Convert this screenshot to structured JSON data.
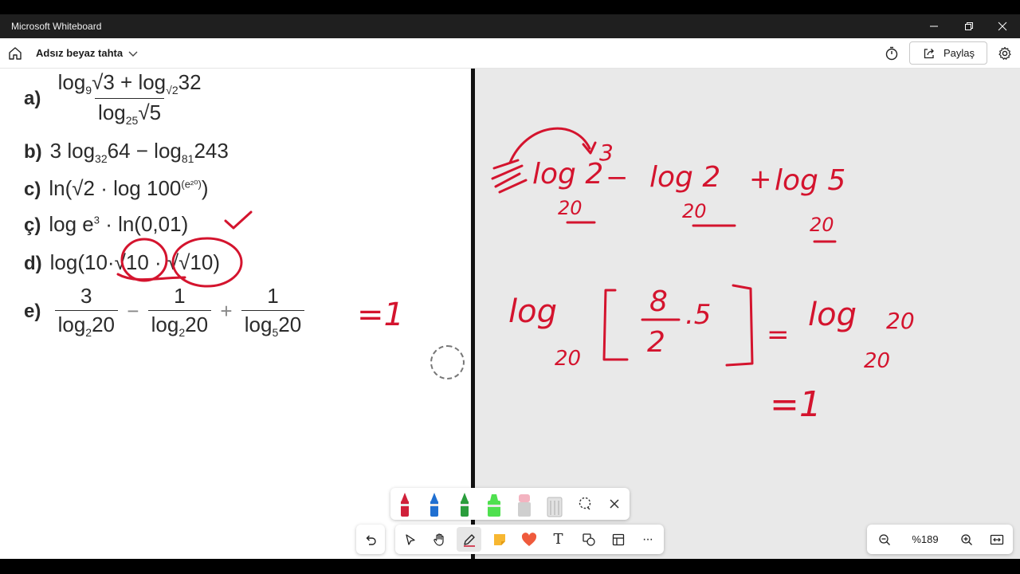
{
  "window": {
    "app_title": "Microsoft Whiteboard",
    "minimize_label": "–",
    "maximize_label": "❐",
    "close_label": "✕"
  },
  "header": {
    "board_title": "Adsız beyaz tahta",
    "share_label": "Paylaş"
  },
  "worksheet": {
    "rows": [
      {
        "label": "a)"
      },
      {
        "label": "b)",
        "text": "3 log"
      },
      {
        "label": "c)"
      },
      {
        "label": "ç)"
      },
      {
        "label": "d)"
      },
      {
        "label": "e)"
      }
    ],
    "a": {
      "num_1": "log",
      "sub_1": "9",
      "arg_1": "√3 + log",
      "sub_2": "√2",
      "arg_2": "32",
      "den_1": "log",
      "den_sub": "25",
      "den_arg": "√5"
    },
    "b": {
      "p1": "3 log",
      "s1": "32",
      "p2": "64 − log",
      "s2": "81",
      "p3": "243"
    },
    "c": {
      "p1": "ln(√2 · log 100",
      "sup": "(e²⁰)",
      "p2": ")"
    },
    "cc": {
      "p1": "log e",
      "sup": "3",
      "p2": " · ln(0,01)"
    },
    "d": {
      "p1": "log(10·√10 · √√10)"
    },
    "e": {
      "f1_num": "3",
      "f1_den": "log",
      "f1_sub": "2",
      "f1_arg": "20",
      "op1": "−",
      "f2_num": "1",
      "f2_den": "log",
      "f2_sub": "2",
      "f2_arg": "20",
      "op2": "+",
      "f3_num": "1",
      "f3_den": "log",
      "f3_sub": "5",
      "f3_arg": "20"
    }
  },
  "handwriting": {
    "e_answer": "=1",
    "line1_a": "log 2",
    "line1_a_sup": "3",
    "line1_a_base": "20",
    "line1_op1": "−",
    "line1_b": "log 2",
    "line1_b_base": "20",
    "line1_op2": "+",
    "line1_c": "log 5",
    "line1_c_base": "20",
    "line2_left": "log",
    "line2_left_base": "20",
    "line2_bracket_num": "8",
    "line2_bracket_den": "2",
    "line2_bracket_mult": ".5",
    "line2_eq": "=",
    "line2_right": "log",
    "line2_right_base": "20",
    "line2_right_arg": "20",
    "line3": "=1"
  },
  "pen_tray": {
    "pens": [
      {
        "name": "red-pen",
        "color": "#d0203a"
      },
      {
        "name": "blue-pen",
        "color": "#1f6fd1"
      },
      {
        "name": "green-pen",
        "color": "#2a9d3c"
      },
      {
        "name": "highlighter-green",
        "color": "#4fe04f"
      },
      {
        "name": "eraser",
        "color": "#f3b3c0"
      },
      {
        "name": "ruler",
        "color": "#cfcfcf"
      }
    ]
  },
  "toolbar": {
    "text_tool_label": "T",
    "more_label": "···"
  },
  "zoom": {
    "level": "%189"
  },
  "colors": {
    "ink": "#d4142e",
    "canvas_bg": "#e9e9e9",
    "titlebar_bg": "#1f1f1f"
  }
}
